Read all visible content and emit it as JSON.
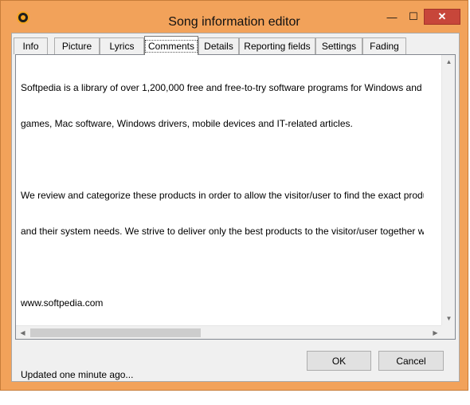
{
  "window": {
    "title": "Song information editor",
    "minimize_glyph": "—",
    "maximize_glyph": "☐",
    "close_glyph": "✕"
  },
  "tabs": [
    {
      "label": "Info"
    },
    {
      "label": "Picture"
    },
    {
      "label": "Lyrics"
    },
    {
      "label": "Comments",
      "active": true
    },
    {
      "label": "Details"
    },
    {
      "label": "Reporting fields"
    },
    {
      "label": "Settings"
    },
    {
      "label": "Fading"
    }
  ],
  "comments": {
    "line1": "Softpedia is a library of over 1,200,000 free and free-to-try software programs for Windows and Unix/Linux,",
    "line2": "games, Mac software, Windows drivers, mobile devices and IT-related articles.",
    "line3": "We review and categorize these products in order to allow the visitor/user to find the exact product they",
    "line4": "and their system needs. We strive to deliver only the best products to the visitor/user together with self-made",
    "line5": "www.softpedia.com",
    "line6": "Updated one minute ago..."
  },
  "buttons": {
    "ok": "OK",
    "cancel": "Cancel"
  }
}
